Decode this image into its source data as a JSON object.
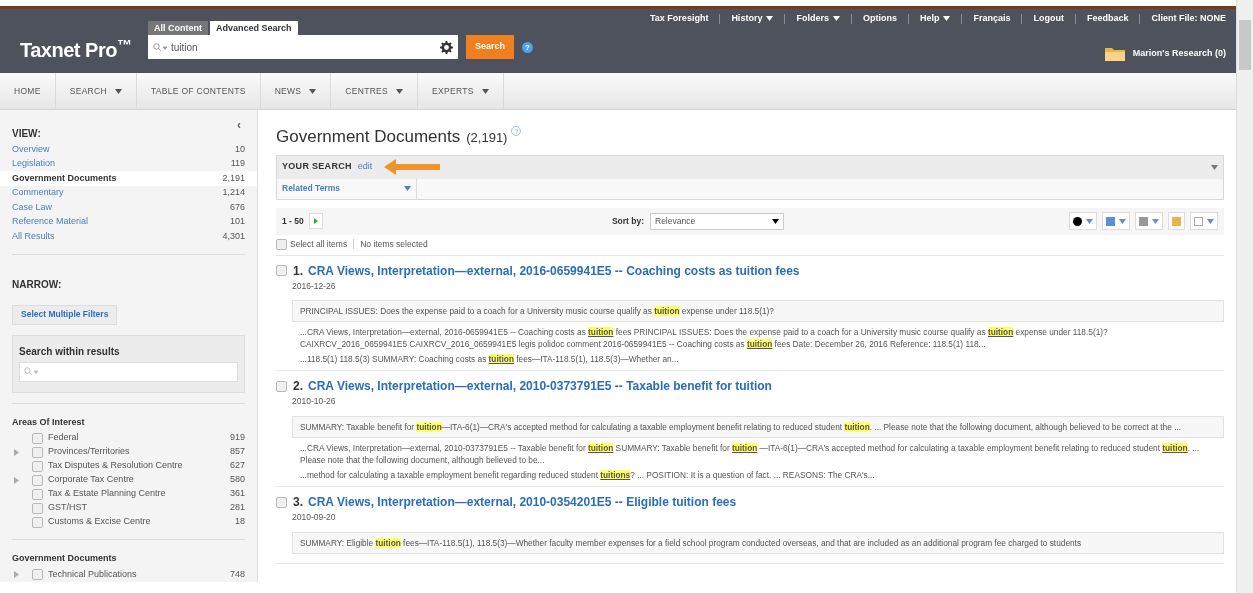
{
  "header": {
    "logo": "Taxnet Pro$^{™}$",
    "search_tabs": [
      {
        "label": "All Content",
        "selected": false
      },
      {
        "label": "Advanced Search",
        "selected": true
      }
    ],
    "search": {
      "value": "tuition"
    },
    "search_button": "Search",
    "help": "?",
    "top_links": [
      {
        "label": "Tax Foresight",
        "dropdown": false
      },
      {
        "label": "History",
        "dropdown": true
      },
      {
        "label": "Folders",
        "dropdown": true
      },
      {
        "label": "Options",
        "dropdown": false
      },
      {
        "label": "Help",
        "dropdown": true
      },
      {
        "label": "Français",
        "dropdown": false
      },
      {
        "label": "Logout",
        "dropdown": false
      },
      {
        "label": "Feedback",
        "dropdown": false
      },
      {
        "label": "Client File: NONE",
        "dropdown": false
      }
    ],
    "research_folder": "Marion's Research (0)"
  },
  "nav": [
    {
      "label": "HOME",
      "dropdown": false
    },
    {
      "label": "SEARCH",
      "dropdown": true
    },
    {
      "label": "TABLE OF CONTENTS",
      "dropdown": false
    },
    {
      "label": "NEWS",
      "dropdown": true
    },
    {
      "label": "CENTRES",
      "dropdown": true
    },
    {
      "label": "EXPERTS",
      "dropdown": true
    }
  ],
  "sidebar": {
    "collapse": "‹",
    "view_title": "VIEW:",
    "view_items": [
      {
        "label": "Overview",
        "count": "10",
        "selected": false
      },
      {
        "label": "Legislation",
        "count": "119",
        "selected": false
      },
      {
        "label": "Government Documents",
        "count": "2,191",
        "selected": true
      },
      {
        "label": "Commentary",
        "count": "1,214",
        "selected": false
      },
      {
        "label": "Case Law",
        "count": "676",
        "selected": false
      },
      {
        "label": "Reference Material",
        "count": "101",
        "selected": false
      },
      {
        "label": "All Results",
        "count": "4,301",
        "selected": false
      }
    ],
    "narrow_title": "NARROW:",
    "filters_button": "Select Multiple Filters",
    "within_title": "Search within results",
    "facet_groups": [
      {
        "title": "Areas Of Interest",
        "items": [
          {
            "label": "Federal",
            "count": "919",
            "checked": false,
            "expandable": false
          },
          {
            "label": "Provinces/Territories",
            "count": "857",
            "checked": false,
            "expandable": true
          },
          {
            "label": "Tax Disputes & Resolution Centre",
            "count": "627",
            "checked": false,
            "expandable": false
          },
          {
            "label": "Corporate Tax Centre",
            "count": "580",
            "checked": false,
            "expandable": true
          },
          {
            "label": "Tax & Estate Planning Centre",
            "count": "361",
            "checked": false,
            "expandable": false
          },
          {
            "label": "GST/HST",
            "count": "281",
            "checked": false,
            "expandable": false
          },
          {
            "label": "Customs & Excise Centre",
            "count": "18",
            "checked": false,
            "expandable": false
          }
        ]
      },
      {
        "title": "Government Documents",
        "items": [
          {
            "label": "Technical Publications",
            "count": "748",
            "checked": false,
            "expandable": true
          }
        ]
      }
    ]
  },
  "main": {
    "title": "Government Documents",
    "count": "(2,191)",
    "title_help": "?",
    "select_all_checked": false,
    "your_search": "YOUR SEARCH",
    "edit": "edit",
    "related_terms": "Related Terms",
    "range": "1 - 50",
    "sort_label": "Sort by:",
    "sort_value": "Relevance",
    "select_all": "Select all items",
    "selected_info": "No items selected",
    "results": [
      {
        "number": "1.",
        "title": "CRA Views, Interpretation—external, 2016-0659941E5 -- Coaching costs as tuition fees",
        "date": "2016-12-26",
        "checked": false,
        "snippets": [
          {
            "kind": "summary",
            "parts": [
              {
                "text": "PRINCIPAL ISSUES: Does the expense paid to a coach for a University music course qualify as ",
                "highlight": false
              },
              {
                "text": "tuition",
                "highlight": true
              },
              {
                "text": " expense under 118.5(1)?",
                "highlight": false
              }
            ]
          },
          {
            "kind": "excerpt",
            "parts": [
              {
                "text": "...CRA Views, Interpretation—external, 2016-0659941E5 -- Coaching costs as ",
                "highlight": false
              },
              {
                "text": "tuition",
                "highlight": true
              },
              {
                "text": " fees PRINCIPAL ISSUES: Does the expense paid to a coach for a University music course qualify as ",
                "highlight": false
              },
              {
                "text": "tuition",
                "highlight": true
              },
              {
                "text": " expense under 118.5(1)? CAIXRCV_2016_0659941E5 CAIXRCV_2016_0659941E5 legis polidoc comment 2016-0659941E5 -- Coaching costs as ",
                "highlight": false
              },
              {
                "text": "tuition",
                "highlight": true
              },
              {
                "text": " fees Date: December 26, 2016 Reference: 118.5(1) 118...",
                "highlight": false
              }
            ]
          },
          {
            "kind": "excerpt",
            "parts": [
              {
                "text": "...118.5(1) 118.5(3) SUMMARY: Coaching costs as ",
                "highlight": false
              },
              {
                "text": "tuition",
                "highlight": true
              },
              {
                "text": " fees—ITA-118.5(1), 118.5(3)—Whether an...",
                "highlight": false
              }
            ]
          }
        ]
      },
      {
        "number": "2.",
        "title": "CRA Views, Interpretation—external, 2010-0373791E5 -- Taxable benefit for tuition",
        "date": "2010-10-26",
        "checked": false,
        "snippets": [
          {
            "kind": "summary",
            "parts": [
              {
                "text": "SUMMARY: Taxable benefit for ",
                "highlight": false
              },
              {
                "text": "tuition",
                "highlight": true
              },
              {
                "text": "—ITA-6(1)—CRA's accepted method for calculating a taxable employment benefit relating to reduced student ",
                "highlight": false
              },
              {
                "text": "tuition",
                "highlight": true
              },
              {
                "text": ". ... Please note that the following document, although believed to be correct at the ...",
                "highlight": false
              }
            ]
          },
          {
            "kind": "excerpt",
            "parts": [
              {
                "text": "...CRA Views, Interpretation—external, 2010-0373791E5 -- Taxable benefit for ",
                "highlight": false
              },
              {
                "text": "tuition",
                "highlight": true
              },
              {
                "text": " SUMMARY: Taxable benefit for ",
                "highlight": false
              },
              {
                "text": "tuition",
                "highlight": true
              },
              {
                "text": " —ITA-6(1)—CRA's accepted method for calculating a taxable employment benefit relating to reduced student ",
                "highlight": false
              },
              {
                "text": "tuition",
                "highlight": true
              },
              {
                "text": ". ... Please note that the following document, although believed to be...",
                "highlight": false
              }
            ]
          },
          {
            "kind": "excerpt",
            "parts": [
              {
                "text": "...method for calculating a taxable employment benefit regarding reduced student ",
                "highlight": false
              },
              {
                "text": "tuitions",
                "highlight": true
              },
              {
                "text": "? ... POSITION: It is a question of fact. ... REASONS: The CRA's...",
                "highlight": false
              }
            ]
          }
        ]
      },
      {
        "number": "3.",
        "title": "CRA Views, Interpretation—external, 2010-0354201E5 -- Eligible tuition fees",
        "date": "2010-09-20",
        "checked": false,
        "snippets": [
          {
            "kind": "summary",
            "parts": [
              {
                "text": "SUMMARY: Eligible ",
                "highlight": false
              },
              {
                "text": "tuition",
                "highlight": true
              },
              {
                "text": " fees—ITA-118.5(1), 118.5(3)—Whether faculty member expenses for a field school program conducted overseas, and that are included as an additional program fee charged to students",
                "highlight": false
              }
            ]
          }
        ]
      }
    ]
  }
}
